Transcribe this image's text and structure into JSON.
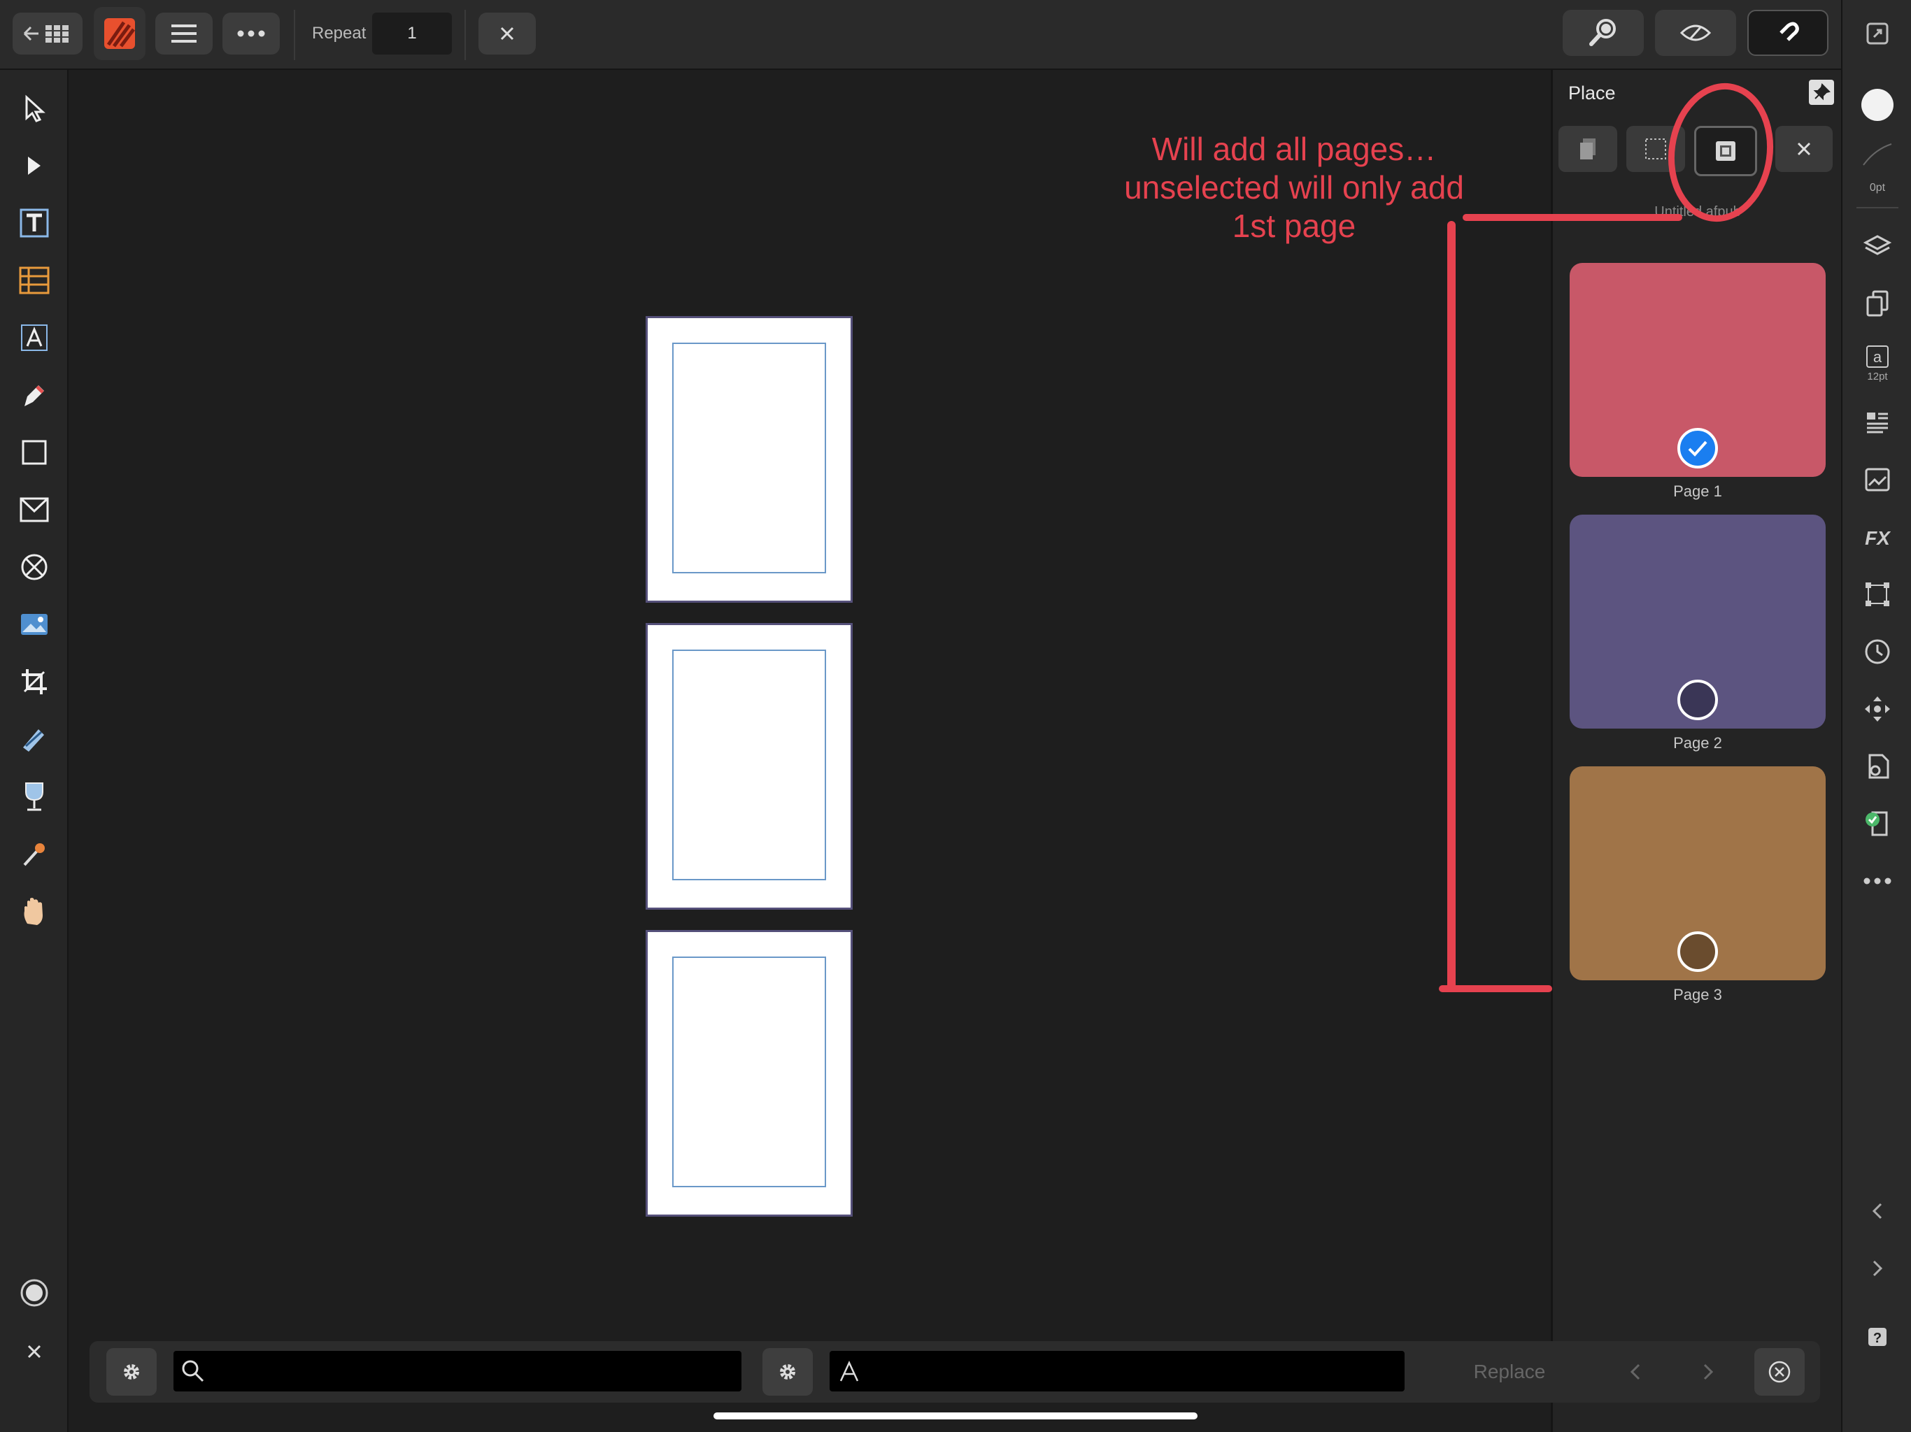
{
  "topbar": {
    "repeat_label": "Repeat",
    "repeat_value": "1"
  },
  "panel": {
    "title": "Place",
    "document_name": "Untitled.afpub",
    "pages": [
      {
        "label": "Page 1",
        "color": "#c85868",
        "selected": true
      },
      {
        "label": "Page 2",
        "color": "#5c5480",
        "selected": false
      },
      {
        "label": "Page 3",
        "color": "#a07448",
        "selected": false
      }
    ]
  },
  "right_strip": {
    "stroke_width": "0pt",
    "font_size": "12pt"
  },
  "bottom_bar": {
    "find_value": "",
    "replace_value": "",
    "replace_label": "Replace"
  },
  "annotation": {
    "line1": "Will add all pages…",
    "line2": "unselected will only add",
    "line3": "1st page",
    "color": "#e6424f"
  }
}
